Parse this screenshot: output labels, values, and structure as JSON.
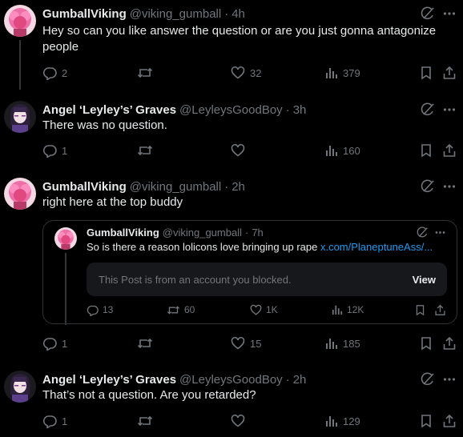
{
  "colors": {
    "background": "#000000",
    "text": "#e7e9ea",
    "muted": "#71767b",
    "link": "#1d9bf0",
    "border": "#2f3336"
  },
  "icons": {
    "reply": "reply-icon",
    "repost": "repost-icon",
    "like": "heart-icon",
    "views": "views-icon",
    "bookmark": "bookmark-icon",
    "share": "share-icon",
    "grok": "grok-icon",
    "more": "more-icon"
  },
  "posts": [
    {
      "name": "GumballViking",
      "handle": "@viking_gumball",
      "sep": "·",
      "time": "4h",
      "text": "Hey so can you like answer the question or are you just gonna antagonize people",
      "replies": "2",
      "reposts": "",
      "likes": "32",
      "views": "379"
    },
    {
      "name": "Angel ‘Leyley’s’ Graves",
      "handle": "@LeyleysGoodBoy",
      "sep": "·",
      "time": "3h",
      "text": "There was no question.",
      "replies": "1",
      "reposts": "",
      "likes": "",
      "views": "160"
    },
    {
      "name": "GumballViking",
      "handle": "@viking_gumball",
      "sep": "·",
      "time": "2h",
      "text": "right here at the top buddy",
      "replies": "1",
      "reposts": "",
      "likes": "15",
      "views": "185",
      "quote": {
        "name": "GumballViking",
        "handle": "@viking_gumball",
        "sep": "·",
        "time": "7h",
        "text": "So is there a reason lolicons love bringing up rape ",
        "link": "x.com/PlaneptuneAss/...",
        "blocked_notice": "This Post is from an account you blocked.",
        "view_label": "View",
        "replies": "13",
        "reposts": "60",
        "likes": "1K",
        "views": "12K"
      }
    },
    {
      "name": "Angel ‘Leyley’s’ Graves",
      "handle": "@LeyleysGoodBoy",
      "sep": "·",
      "time": "2h",
      "text": "That’s not a question. Are you retarded?",
      "replies": "1",
      "reposts": "",
      "likes": "",
      "views": "129"
    }
  ]
}
